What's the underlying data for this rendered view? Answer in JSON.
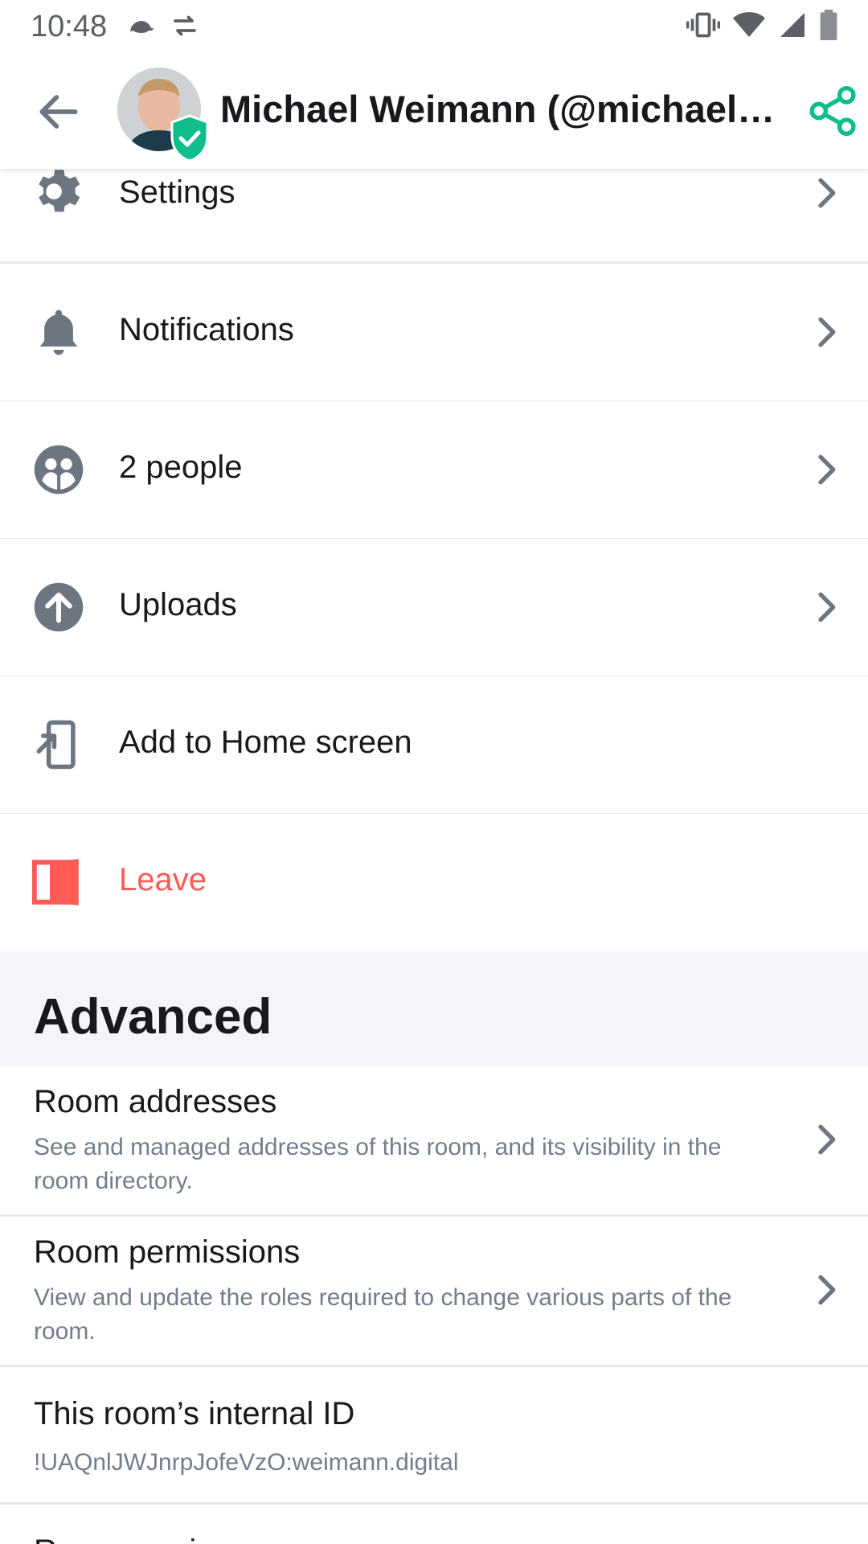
{
  "status_bar": {
    "time": "10:48",
    "left_icons": [
      "turtle-icon",
      "data-saver-icon"
    ],
    "right_icons": [
      "vibrate-icon",
      "wifi-icon",
      "cell-signal-icon",
      "battery-icon"
    ]
  },
  "app_bar": {
    "title": "Michael Weimann (@michaelw:…",
    "verified": true,
    "accent_color": "#0dbd8b"
  },
  "menu": [
    {
      "label": "Settings",
      "icon": "gear-icon",
      "has_chevron": true
    },
    {
      "label": "Notifications",
      "icon": "bell-icon",
      "has_chevron": true
    },
    {
      "label": "2 people",
      "icon": "people-icon",
      "has_chevron": true
    },
    {
      "label": "Uploads",
      "icon": "upload-icon",
      "has_chevron": true
    },
    {
      "label": "Add to Home screen",
      "icon": "add-to-home-icon",
      "has_chevron": false
    },
    {
      "label": "Leave",
      "icon": "leave-door-icon",
      "has_chevron": false,
      "color": "#ff5b55"
    }
  ],
  "advanced": {
    "title": "Advanced",
    "items": [
      {
        "title": "Room addresses",
        "description": "See and managed addresses of this room, and its visibility in the room directory."
      },
      {
        "title": "Room permissions",
        "description": "View and update the roles required to change various parts of the room."
      },
      {
        "title": "This room’s internal ID",
        "description": "!UAQnlJWJnrpJofeVzO:weimann.digital"
      }
    ],
    "partial_next_item": "Room version"
  },
  "colors": {
    "icon_gray": "#6c7580",
    "divider": "#e3e8f0",
    "section_bg": "#f3f5f8",
    "danger": "#ff5b55"
  }
}
